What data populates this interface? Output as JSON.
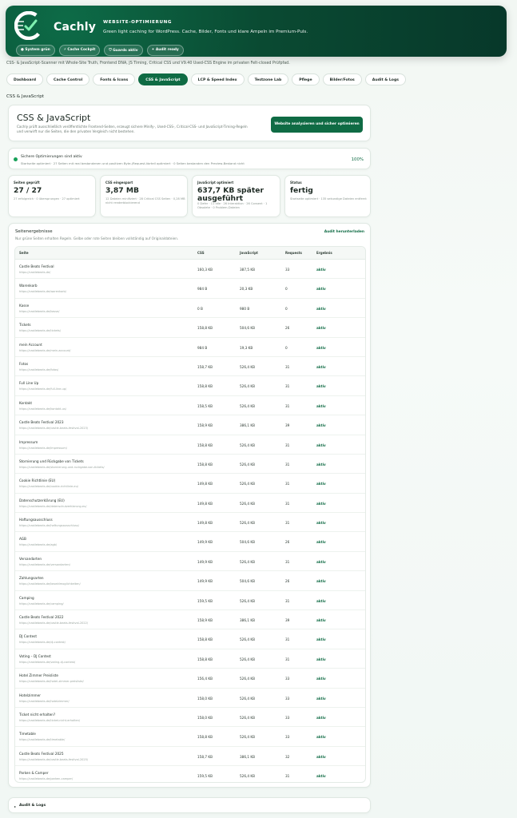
{
  "hero": {
    "brand": "Cachly",
    "tag": "WEBSITE-OPTIMIERUNG",
    "subtitle": "Green light caching for WordPress. Cache, Bilder, Fonts und klare Ampeln im Premium-Puls.",
    "buttons": [
      {
        "icon": "dot-icon",
        "glyph": "●",
        "label": "System grün"
      },
      {
        "icon": "bolt-icon",
        "glyph": "⚡",
        "label": "Cache Cockpit"
      },
      {
        "icon": "shield-icon",
        "glyph": "⛉",
        "label": "Guards aktiv"
      },
      {
        "icon": "spark-icon",
        "glyph": "✦",
        "label": "Audit ready"
      }
    ]
  },
  "intro": "CSS- & JavaScript-Scanner mit Whole-Site Truth, Frontend DNA, JS Timing, Critical CSS und V9.40 Used-CSS Engine im privaten Felt-closed Prüfpfad.",
  "tabs": [
    {
      "label": "Dashboard",
      "active": false
    },
    {
      "label": "Cache Control",
      "active": false
    },
    {
      "label": "Fonts & Icons",
      "active": false
    },
    {
      "label": "CSS & JavaScript",
      "active": true
    },
    {
      "label": "LCP & Speed Index",
      "active": false
    },
    {
      "label": "Testzone Lab",
      "active": false
    },
    {
      "label": "Pflege",
      "active": false
    },
    {
      "label": "Bilder/Fotos",
      "active": false
    },
    {
      "label": "Audit & Logs",
      "active": false
    }
  ],
  "section_label": "CSS & JavaScript",
  "title_card": {
    "title": "CSS & JavaScript",
    "description": "Cachly prüft ausschließlich veröffentlichte Frontend-Seiten, erzeugt sichere Minify-, Used-CSS-, Critical-CSS- und JavaScript-Timing-Regeln und verwirft nur die Seiten, die den privaten Vergleich nicht bestehen.",
    "button": "Website analysieren und sicher optimieren"
  },
  "status": {
    "title": "Sichere Optimierungen sind aktiv",
    "description": "Startseite optimiert · 27 Seiten mit real bestandenen und positiven Byte-/Request-Vorteil optimiert · 0 Seiten bestanden den Preview-Bestand nicht",
    "percent": "100%",
    "dot_color": "#17a058"
  },
  "stats": [
    {
      "label": "Seiten geprüft",
      "value": "27 / 27",
      "note": "27 erfolgreich · 0 übersprungen · 27 optimiert"
    },
    {
      "label": "CSS eingespart",
      "value": "3,87 MB",
      "note": "12 Dateien minifiziert · 28 Critical CSS Seiten · 0,28 MB nicht renderblockierend"
    },
    {
      "label": "JavaScript optimiert",
      "value": "637,7 KB später ausgeführt",
      "note": "0 Defer · 11 Idle · 26 Interaktion · 26 Consent · 1 Obsolete · 0 Problem-Dateien"
    },
    {
      "label": "Status",
      "value": "fertig",
      "note": "Startseite optimiert · 135 sekundige Dateien entfernt"
    }
  ],
  "results": {
    "title": "Seitenergebnisse",
    "subtitle": "Nur grüne Seiten erhalten Regeln. Gelbe oder rote Seiten bleiben vollständig auf Originaldateien.",
    "download": "Audit herunterladen",
    "columns": [
      "Seite",
      "CSS",
      "JavaScript",
      "Requests",
      "Ergebnis"
    ],
    "rows": [
      {
        "name": "Castle Beats Festival",
        "url": "https://castlebeats.de/",
        "css": "160,3 KB",
        "js": "387,5 KB",
        "req": "33",
        "status": "aktiv"
      },
      {
        "name": "Warenkorb",
        "url": "https://castlebeats.de/warenkorb/",
        "css": "984 B",
        "js": "20,3 KB",
        "req": "0",
        "status": "aktiv"
      },
      {
        "name": "Kasse",
        "url": "https://castlebeats.de/kasse/",
        "css": "0 B",
        "js": "980 B",
        "req": "0",
        "status": "aktiv"
      },
      {
        "name": "Tickets",
        "url": "https://castlebeats.de/tickets/",
        "css": "158,8 KB",
        "js": "504,6 KB",
        "req": "26",
        "status": "aktiv"
      },
      {
        "name": "mein Account",
        "url": "https://castlebeats.de/mein-account/",
        "css": "984 B",
        "js": "19,3 KB",
        "req": "0",
        "status": "aktiv"
      },
      {
        "name": "Fotos",
        "url": "https://castlebeats.de/fotos/",
        "css": "158,7 KB",
        "js": "526,4 KB",
        "req": "31",
        "status": "aktiv"
      },
      {
        "name": "Full Line Up",
        "url": "https://castlebeats.de/full-line-up/",
        "css": "158,8 KB",
        "js": "526,4 KB",
        "req": "31",
        "status": "aktiv"
      },
      {
        "name": "Kontakt",
        "url": "https://castlebeats.de/kontakt-us/",
        "css": "158,5 KB",
        "js": "526,4 KB",
        "req": "31",
        "status": "aktiv"
      },
      {
        "name": "Castle Beats Festival 2023",
        "url": "https://castlebeats.de/castle-beats-festival-2023/",
        "css": "158,9 KB",
        "js": "386,1 KB",
        "req": "39",
        "status": "aktiv"
      },
      {
        "name": "Impressum",
        "url": "https://castlebeats.de/impressum/",
        "css": "158,8 KB",
        "js": "526,4 KB",
        "req": "31",
        "status": "aktiv"
      },
      {
        "name": "Stornierung und Rückgabe von Tickets",
        "url": "https://castlebeats.de/stornierung-und-ruckgabe-von-tickets/",
        "css": "158,8 KB",
        "js": "526,4 KB",
        "req": "31",
        "status": "aktiv"
      },
      {
        "name": "Cookie Richtlinie (EU)",
        "url": "https://castlebeats.de/cookie-richtlinie-eu/",
        "css": "149,8 KB",
        "js": "526,4 KB",
        "req": "31",
        "status": "aktiv"
      },
      {
        "name": "Datenschutzerklärung (EU)",
        "url": "https://castlebeats.de/datenschutzerklarung-eu/",
        "css": "149,8 KB",
        "js": "526,4 KB",
        "req": "31",
        "status": "aktiv"
      },
      {
        "name": "Haftungsausschluss",
        "url": "https://castlebeats.de/haftungsausschluss/",
        "css": "149,8 KB",
        "js": "526,4 KB",
        "req": "31",
        "status": "aktiv"
      },
      {
        "name": "AGB",
        "url": "https://castlebeats.de/agb/",
        "css": "149,9 KB",
        "js": "504,6 KB",
        "req": "26",
        "status": "aktiv"
      },
      {
        "name": "Versandarten",
        "url": "https://castlebeats.de/versandarten/",
        "css": "149,9 KB",
        "js": "526,4 KB",
        "req": "31",
        "status": "aktiv"
      },
      {
        "name": "Zahlungsarten",
        "url": "https://castlebeats.de/bezahlmoglichkeiten/",
        "css": "149,9 KB",
        "js": "504,6 KB",
        "req": "26",
        "status": "aktiv"
      },
      {
        "name": "Camping",
        "url": "https://castlebeats.de/camping/",
        "css": "159,5 KB",
        "js": "526,4 KB",
        "req": "31",
        "status": "aktiv"
      },
      {
        "name": "Castle Beats Festival 2022",
        "url": "https://castlebeats.de/castle-beats-festival-2022/",
        "css": "158,9 KB",
        "js": "386,1 KB",
        "req": "39",
        "status": "aktiv"
      },
      {
        "name": "DJ Contest",
        "url": "https://castlebeats.de/dj-contest/",
        "css": "158,8 KB",
        "js": "526,4 KB",
        "req": "31",
        "status": "aktiv"
      },
      {
        "name": "Voting – DJ Contest",
        "url": "https://castlebeats.de/voting-dj-contest/",
        "css": "158,8 KB",
        "js": "526,4 KB",
        "req": "31",
        "status": "aktiv"
      },
      {
        "name": "Hotel Zimmer Preisliste",
        "url": "https://castlebeats.de/hotel-zimmer-preisliste/",
        "css": "156,4 KB",
        "js": "526,4 KB",
        "req": "33",
        "status": "aktiv"
      },
      {
        "name": "Hotelzimmer",
        "url": "https://castlebeats.de/hotelzimmer/",
        "css": "158,0 KB",
        "js": "526,4 KB",
        "req": "33",
        "status": "aktiv"
      },
      {
        "name": "Ticket nicht erhalten?",
        "url": "https://castlebeats.de/ticket-nicht-erhalten/",
        "css": "158,0 KB",
        "js": "526,4 KB",
        "req": "33",
        "status": "aktiv"
      },
      {
        "name": "Timetable",
        "url": "https://castlebeats.de/timetable/",
        "css": "158,8 KB",
        "js": "526,4 KB",
        "req": "33",
        "status": "aktiv"
      },
      {
        "name": "Castle Beats Festival 2025",
        "url": "https://castlebeats.de/castle-beats-festival-2025/",
        "css": "158,7 KB",
        "js": "386,1 KB",
        "req": "32",
        "status": "aktiv"
      },
      {
        "name": "Parken & Camper",
        "url": "https://castlebeats.de/parken-camper/",
        "css": "159,5 KB",
        "js": "526,4 KB",
        "req": "31",
        "status": "aktiv"
      }
    ]
  },
  "audit_section": {
    "label": "Audit & Logs",
    "caret": "▸"
  }
}
